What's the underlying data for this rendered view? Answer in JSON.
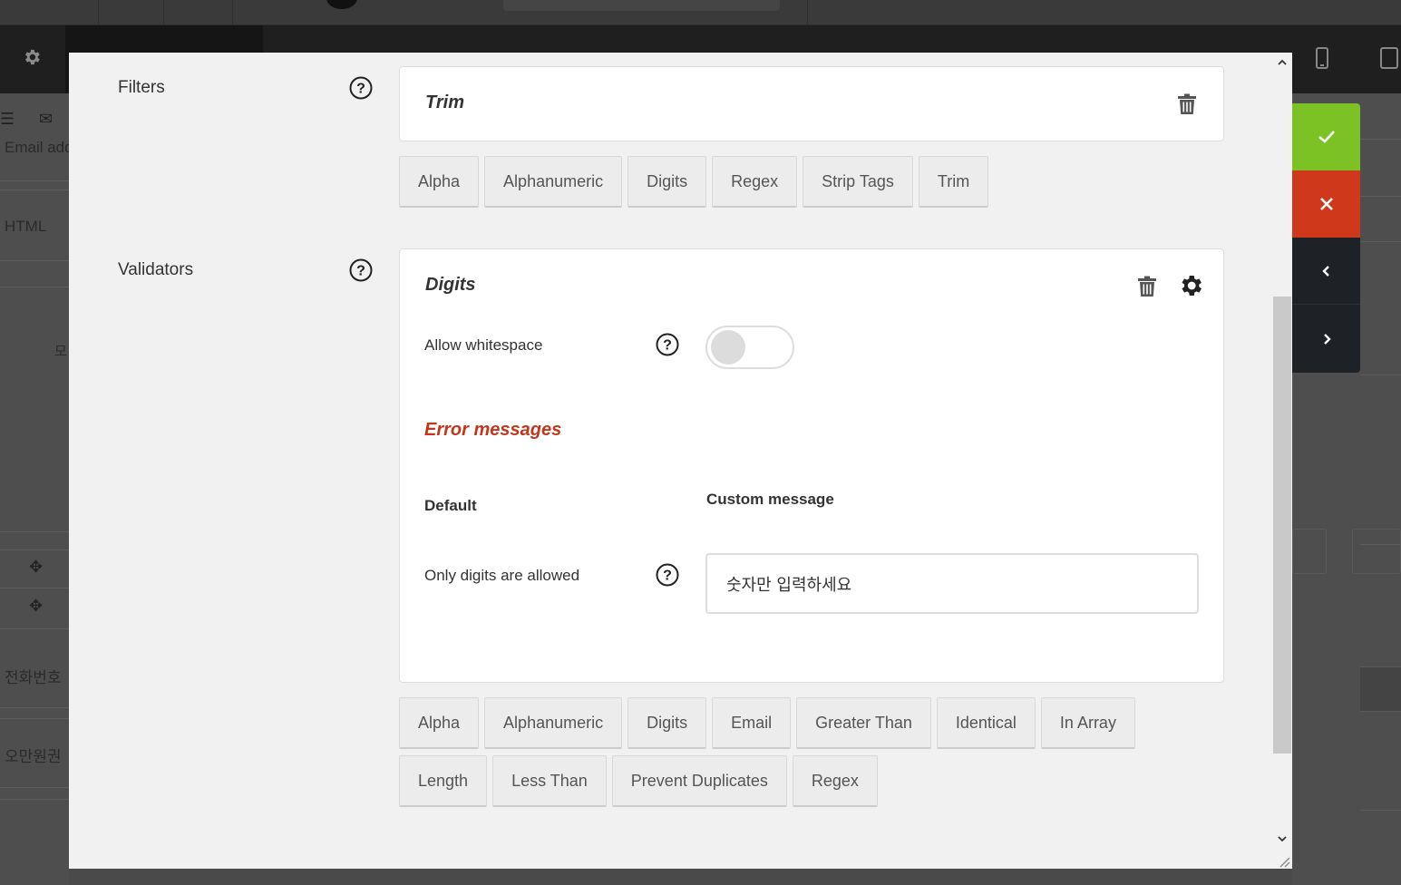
{
  "filters": {
    "label": "Filters",
    "active_filter": "Trim",
    "options": [
      "Alpha",
      "Alphanumeric",
      "Digits",
      "Regex",
      "Strip Tags",
      "Trim"
    ]
  },
  "validators": {
    "label": "Validators",
    "active_validator": {
      "title": "Digits",
      "allow_whitespace_label": "Allow whitespace",
      "allow_whitespace_value": false,
      "error_messages_title": "Error messages",
      "default_col_label": "Default",
      "custom_col_label": "Custom message",
      "message_default": "Only digits are allowed",
      "message_custom": "숫자만 입력하세요"
    },
    "options": [
      "Alpha",
      "Alphanumeric",
      "Digits",
      "Email",
      "Greater Than",
      "Identical",
      "In Array",
      "Length",
      "Less Than",
      "Prevent Duplicates",
      "Regex"
    ]
  },
  "background": {
    "left_texts": [
      "Email add",
      "HTML",
      "모",
      "전화번호",
      "오만원권"
    ]
  },
  "side_actions": {
    "colors": {
      "confirm": "#7dc225",
      "cancel": "#d0381b",
      "nav": "#1e2226"
    }
  },
  "colors": {
    "error_title": "#c4361b",
    "modal_bg": "#f1f1f1"
  },
  "icons": [
    "help-icon",
    "trash-icon",
    "gear-icon",
    "check-icon",
    "close-icon",
    "chevron-left-icon",
    "chevron-right-icon"
  ]
}
